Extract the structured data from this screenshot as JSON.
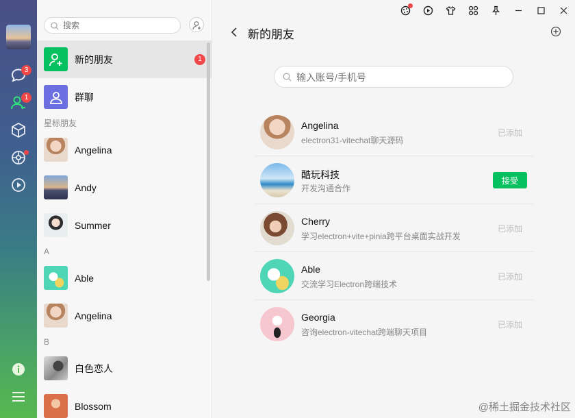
{
  "sidebar": {
    "chat_badge": "3",
    "contacts_badge": "1"
  },
  "contacts": {
    "search_placeholder": "搜索",
    "new_friends": {
      "label": "新的朋友",
      "badge": "1"
    },
    "group_chat": {
      "label": "群聊"
    },
    "sections": [
      {
        "title": "星标朋友",
        "items": [
          "Angelina",
          "Andy",
          "Summer"
        ]
      },
      {
        "title": "A",
        "items": [
          "Able",
          "Angelina"
        ]
      },
      {
        "title": "B",
        "items": [
          "白色恋人",
          "Blossom"
        ]
      }
    ]
  },
  "main": {
    "title": "新的朋友",
    "search_placeholder": "输入账号/手机号",
    "requests": [
      {
        "name": "Angelina",
        "message": "electron31-vitechat聊天源码",
        "status": "已添加"
      },
      {
        "name": "酷玩科技",
        "message": "开发沟通合作",
        "action": "接受"
      },
      {
        "name": "Cherry",
        "message": "学习electron+vite+pinia跨平台桌面实战开发",
        "status": "已添加"
      },
      {
        "name": "Able",
        "message": "交流学习Electron跨端技术",
        "status": "已添加"
      },
      {
        "name": "Georgia",
        "message": "咨询electron-vitechat跨端聊天项目",
        "status": "已添加"
      }
    ]
  },
  "watermark": "@稀土掘金技术社区",
  "colors": {
    "accent": "#07c160",
    "badge": "#f04848"
  }
}
